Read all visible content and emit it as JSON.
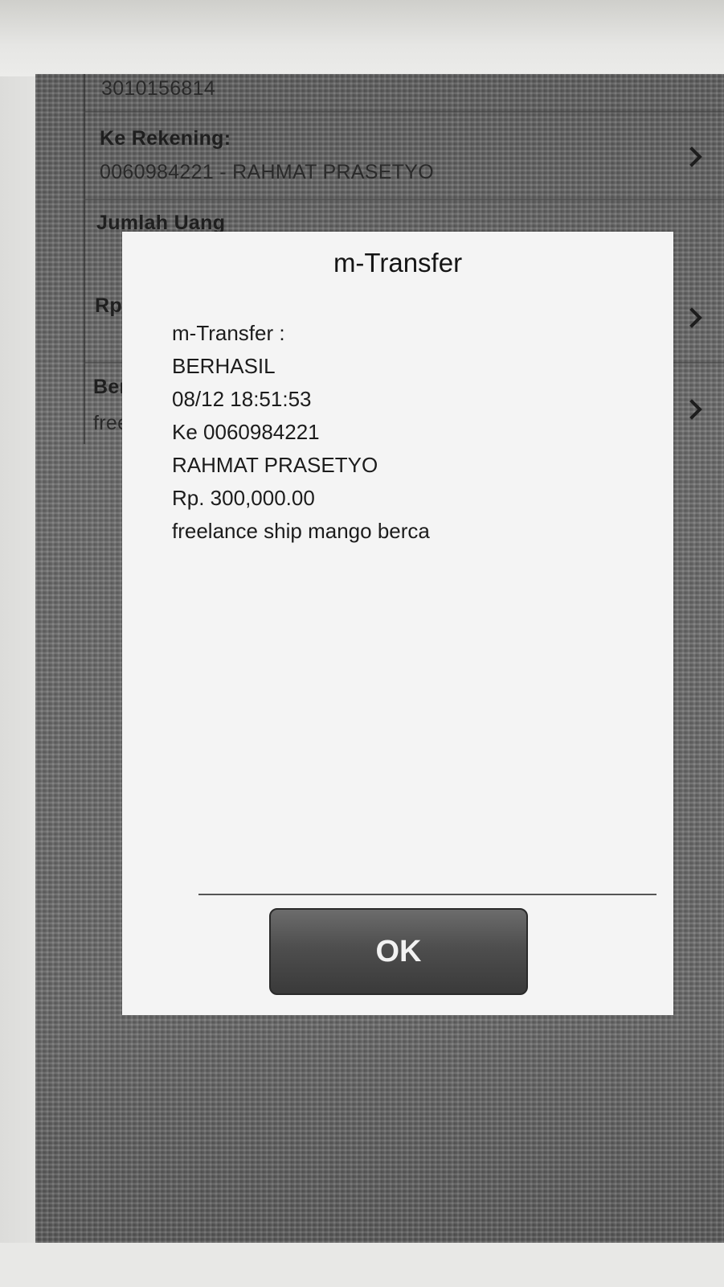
{
  "background": {
    "top_value": "3010156814",
    "to_account_label": "Ke Rekening:",
    "to_account_value": "0060984221 - RAHMAT PRASETYO",
    "amount_label": "Jumlah Uang",
    "amount_prefix": "Rp",
    "note_label_partial": "Ber",
    "note_value_partial": "free"
  },
  "dialog": {
    "title": "m-Transfer",
    "lines": [
      "m-Transfer :",
      "BERHASIL",
      "08/12 18:51:53",
      "Ke 0060984221",
      "RAHMAT PRASETYO",
      "Rp. 300,000.00",
      "freelance ship mango berca"
    ],
    "ok_label": "OK"
  },
  "icons": [
    "chevron-right-icon"
  ]
}
